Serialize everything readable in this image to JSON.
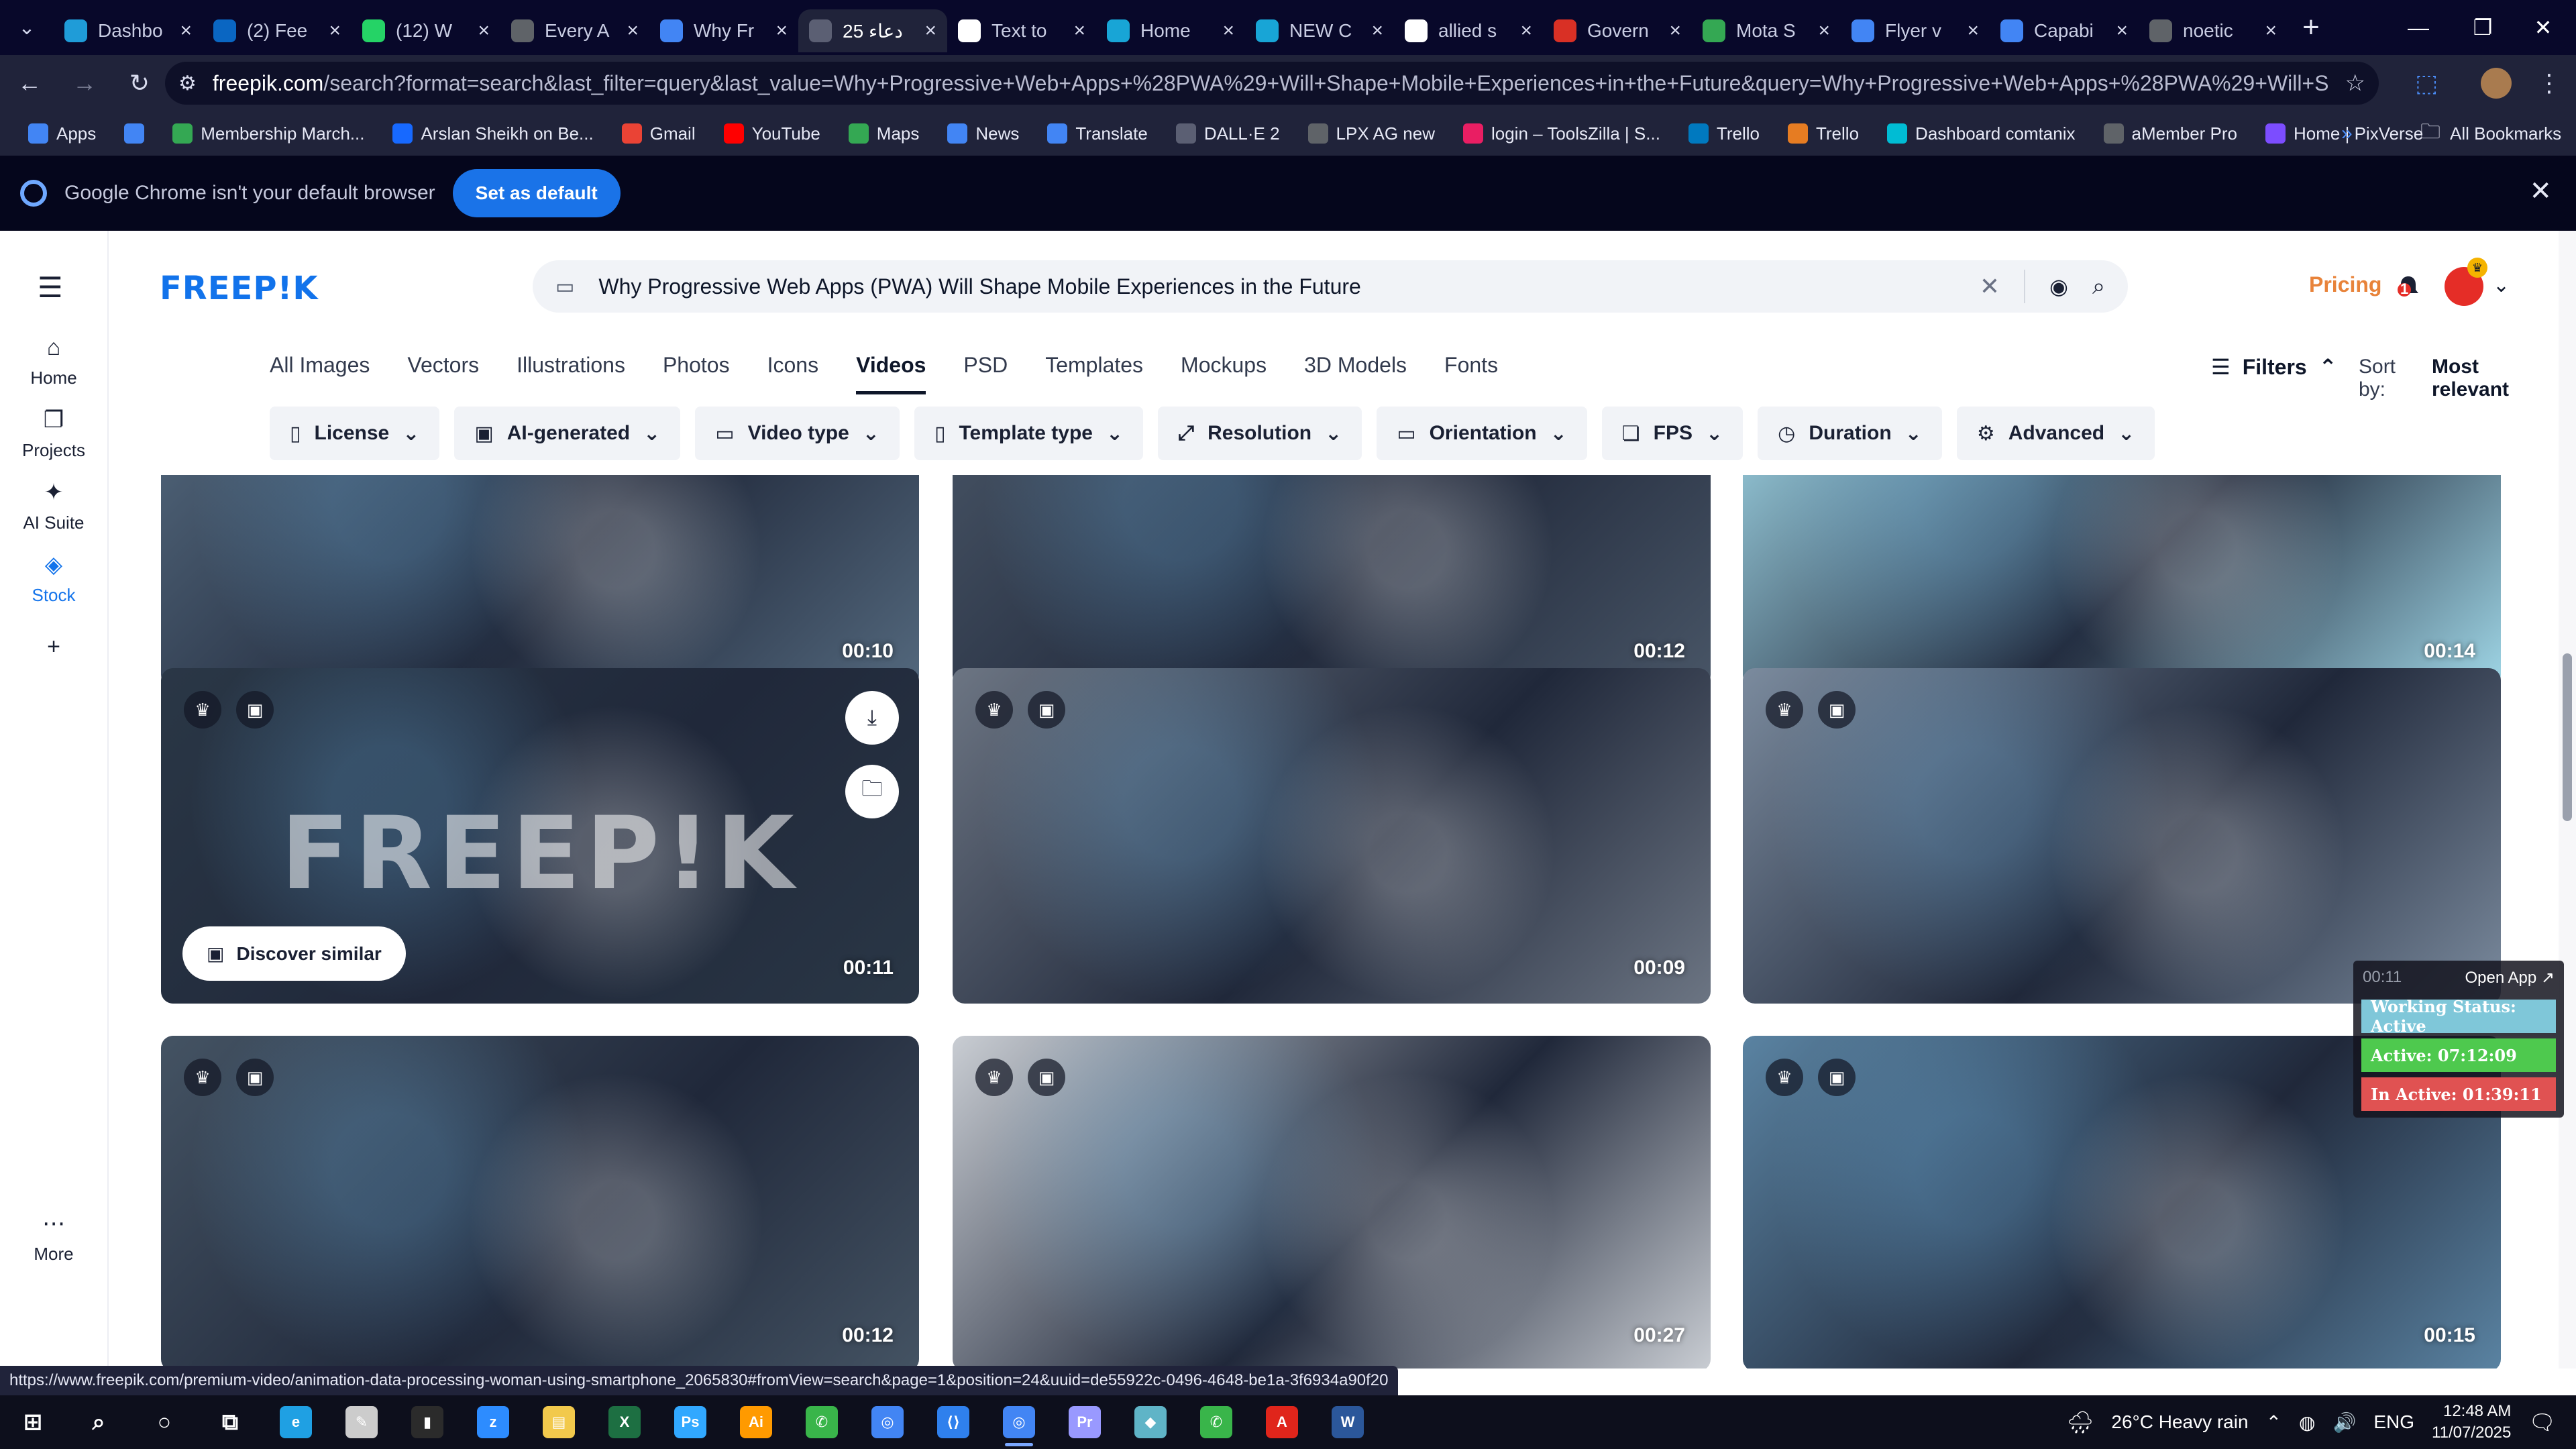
{
  "tabs": [
    {
      "title": "Dashbo",
      "icon": "dashboard-icon",
      "color": "#1f9cd8"
    },
    {
      "title": "(2) Fee",
      "icon": "linkedin-icon",
      "color": "#0a66c2"
    },
    {
      "title": "(12) W",
      "icon": "whatsapp-icon",
      "color": "#25d366"
    },
    {
      "title": "Every A",
      "icon": "globe-icon",
      "color": "#5f6368"
    },
    {
      "title": "Why Fr",
      "icon": "docs-icon",
      "color": "#4285f4"
    },
    {
      "title": "25 دعاء",
      "icon": "openai-icon",
      "color": "#5b5f73",
      "active": true
    },
    {
      "title": "Text to",
      "icon": "notion-icon",
      "color": "#ffffff"
    },
    {
      "title": "Home",
      "icon": "canva-icon",
      "color": "#18a5d6"
    },
    {
      "title": "NEW C",
      "icon": "canva-icon",
      "color": "#18a5d6"
    },
    {
      "title": "allied s",
      "icon": "google-icon",
      "color": "#ffffff"
    },
    {
      "title": "Govern",
      "icon": "gov-icon",
      "color": "#d93025"
    },
    {
      "title": "Mota S",
      "icon": "maps-icon",
      "color": "#34a853"
    },
    {
      "title": "Flyer v",
      "icon": "docs-icon",
      "color": "#4285f4"
    },
    {
      "title": "Capabi",
      "icon": "docs-icon",
      "color": "#4285f4"
    },
    {
      "title": "noetic",
      "icon": "globe-icon",
      "color": "#5f6368"
    }
  ],
  "toolbar": {
    "url_host": "freepik.com",
    "url_rest": "/search?format=search&last_filter=query&last_value=Why+Progressive+Web+Apps+%28PWA%29+Will+Shape+Mobile+Experiences+in+the+Future&query=Why+Progressive+Web+Apps+%28PWA%29+Will+Shape+Mobile+Experiences+in..."
  },
  "bookmarks": [
    {
      "label": "Apps",
      "icon": "apps-grid-icon",
      "color": "#4285f4"
    },
    {
      "label": "",
      "icon": "dashboard-grid-icon",
      "color": "#4285f4"
    },
    {
      "label": "Membership March...",
      "icon": "bookmark-green-icon",
      "color": "#34a853"
    },
    {
      "label": "Arslan Sheikh on Be...",
      "icon": "behance-icon",
      "color": "#1769ff"
    },
    {
      "label": "Gmail",
      "icon": "gmail-icon",
      "color": "#ea4335"
    },
    {
      "label": "YouTube",
      "icon": "youtube-icon",
      "color": "#ff0000"
    },
    {
      "label": "Maps",
      "icon": "maps-icon",
      "color": "#34a853"
    },
    {
      "label": "News",
      "icon": "news-icon",
      "color": "#4285f4"
    },
    {
      "label": "Translate",
      "icon": "translate-icon",
      "color": "#4285f4"
    },
    {
      "label": "DALL·E 2",
      "icon": "openai-icon",
      "color": "#5b5f73"
    },
    {
      "label": "LPX AG new",
      "icon": "globe-icon",
      "color": "#5f6368"
    },
    {
      "label": "login – ToolsZilla | S...",
      "icon": "toolszilla-icon",
      "color": "#e91e63"
    },
    {
      "label": "Trello",
      "icon": "trello-icon",
      "color": "#0079bf"
    },
    {
      "label": "Trello",
      "icon": "trello-icon",
      "color": "#e67c22"
    },
    {
      "label": "Dashboard comtanix",
      "icon": "comtanix-icon",
      "color": "#00bcd4"
    },
    {
      "label": "aMember Pro",
      "icon": "globe-icon",
      "color": "#5f6368"
    },
    {
      "label": "Home | PixVerse",
      "icon": "pixverse-icon",
      "color": "#7c4dff"
    }
  ],
  "all_bookmarks_label": "All Bookmarks",
  "infobar": {
    "message": "Google Chrome isn't your default browser",
    "button": "Set as default"
  },
  "rail": [
    {
      "label": "Home",
      "icon": "home-icon"
    },
    {
      "label": "Projects",
      "icon": "projects-icon"
    },
    {
      "label": "AI Suite",
      "icon": "sparkle-icon"
    },
    {
      "label": "Stock",
      "icon": "stock-icon",
      "active": true
    },
    {
      "label": "",
      "icon": "plus-icon"
    },
    {
      "label": "More",
      "icon": "more-dots-icon"
    }
  ],
  "logo": "FREEP!K",
  "search": {
    "query": "Why Progressive Web Apps (PWA) Will Shape Mobile Experiences in the Future"
  },
  "header": {
    "pricing": "Pricing",
    "notification_count": "1"
  },
  "categories": [
    {
      "label": "All Images"
    },
    {
      "label": "Vectors"
    },
    {
      "label": "Illustrations"
    },
    {
      "label": "Photos"
    },
    {
      "label": "Icons"
    },
    {
      "label": "Videos",
      "active": true
    },
    {
      "label": "PSD"
    },
    {
      "label": "Templates"
    },
    {
      "label": "Mockups"
    },
    {
      "label": "3D Models"
    },
    {
      "label": "Fonts"
    }
  ],
  "filters_label": "Filters",
  "sort": {
    "label": "Sort by:",
    "value": "Most relevant"
  },
  "filter_chips": [
    {
      "label": "License",
      "icon": "license-icon"
    },
    {
      "label": "AI-generated",
      "icon": "ai-icon"
    },
    {
      "label": "Video type",
      "icon": "video-icon"
    },
    {
      "label": "Template type",
      "icon": "template-icon"
    },
    {
      "label": "Resolution",
      "icon": "resolution-icon"
    },
    {
      "label": "Orientation",
      "icon": "orientation-icon"
    },
    {
      "label": "FPS",
      "icon": "fps-icon"
    },
    {
      "label": "Duration",
      "icon": "clock-icon"
    },
    {
      "label": "Advanced",
      "icon": "gear-icon"
    }
  ],
  "cards": [
    {
      "duration": "00:10",
      "bg": "#53687d"
    },
    {
      "duration": "00:12",
      "bg": "#485566"
    },
    {
      "duration": "00:14",
      "bg": "#9fd6e6"
    },
    {
      "duration": "00:11",
      "bg": "#2a3746",
      "hovered": true,
      "watermark": "FREEP!K",
      "discover": "Discover similar"
    },
    {
      "duration": "00:09",
      "bg": "#6c7583"
    },
    {
      "duration": "",
      "bg": "#7b8b9e"
    },
    {
      "duration": "00:12",
      "bg": "#445363"
    },
    {
      "duration": "00:27",
      "bg": "#c9cdd3"
    },
    {
      "duration": "00:15",
      "bg": "#5a83a2"
    }
  ],
  "status_widget": {
    "timer": "00:11",
    "open_app": "Open App ↗",
    "working": "Working Status: Active",
    "active": "Active: 07:12:09",
    "inactive": "In Active: 01:39:11",
    "colors": {
      "working": "#7fc7d9",
      "active": "#4ec94e",
      "inactive": "#e05252"
    }
  },
  "hover_url": "https://www.freepik.com/premium-video/animation-data-processing-woman-using-smartphone_2065830#fromView=search&page=1&position=24&uuid=de55922c-0496-4648-be1a-3f6934a90f20",
  "taskbar": {
    "apps": [
      {
        "icon": "windows-start-icon",
        "color": "#ffffff"
      },
      {
        "icon": "search-icon",
        "color": "#ffffff"
      },
      {
        "icon": "cortana-icon",
        "color": "#ffffff"
      },
      {
        "icon": "task-view-icon",
        "color": "#ffffff"
      },
      {
        "icon": "edge-icon",
        "color": "#1fa0e3"
      },
      {
        "icon": "pen-icon",
        "color": "#cccccc"
      },
      {
        "icon": "terminal-icon",
        "color": "#2b2b2b"
      },
      {
        "icon": "zoom-icon",
        "color": "#2d8cff"
      },
      {
        "icon": "file-explorer-icon",
        "color": "#f2c94c"
      },
      {
        "icon": "excel-icon",
        "color": "#1d6f42"
      },
      {
        "icon": "photoshop-icon",
        "color": "#31a8ff"
      },
      {
        "icon": "illustrator-icon",
        "color": "#ff9a00"
      },
      {
        "icon": "phone-link-icon",
        "color": "#39b54a"
      },
      {
        "icon": "chrome-icon",
        "color": "#4285f4"
      },
      {
        "icon": "vscode-icon",
        "color": "#2f80ed"
      },
      {
        "icon": "chrome-icon",
        "color": "#4285f4",
        "active": true
      },
      {
        "icon": "premiere-icon",
        "color": "#9999ff"
      },
      {
        "icon": "app-diamond-icon",
        "color": "#5fb4c7"
      },
      {
        "icon": "phone-link-icon",
        "color": "#39b54a"
      },
      {
        "icon": "acrobat-icon",
        "color": "#e0251b"
      },
      {
        "icon": "word-icon",
        "color": "#2b579a"
      }
    ],
    "weather": "26°C  Heavy rain",
    "lang": "ENG",
    "time": "12:48 AM",
    "date": "11/07/2025"
  }
}
